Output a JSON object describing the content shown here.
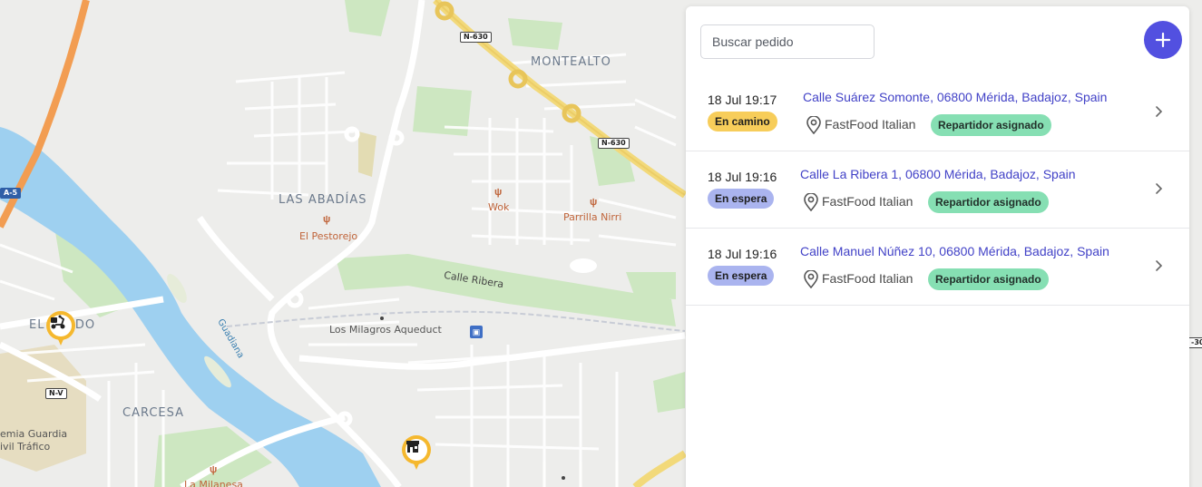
{
  "map": {
    "districts": {
      "montealto": "MONTEALTO",
      "las_abadias": "LAS ABADÍAS",
      "el_prado": "EL PRADO",
      "carcesa": "CARCESA"
    },
    "pois": {
      "wok": "Wok",
      "parrilla": "Parrilla Nirri",
      "pestorejo": "El Pestorejo",
      "milanesa": "La Milanesa",
      "aqueduct": "Los Milagros Aqueduct",
      "academia_line1": "emia Guardia",
      "academia_line2": "ivil Tráfico"
    },
    "streets": {
      "calle_ribera": "Calle Ribera",
      "river": "Guadiana"
    },
    "road_shields": {
      "n630_top": "N-630",
      "n630_right": "N-630",
      "a5": "A-5",
      "nv": "N-V",
      "edge": "-30"
    },
    "marker_icons": {
      "driver": "scooter-icon",
      "restaurant": "store-icon"
    }
  },
  "panel": {
    "search_placeholder": "Buscar pedido",
    "add_icon": "plus-icon",
    "orders": [
      {
        "time": "18 Jul 19:17",
        "status": "En camino",
        "status_color": "#f7cd5a",
        "address": "Calle Suárez Somonte, 06800 Mérida, Badajoz, Spain",
        "restaurant": "FastFood Italian",
        "driver_status": "Repartidor asignado"
      },
      {
        "time": "18 Jul 19:16",
        "status": "En espera",
        "status_color": "#aab4ef",
        "address": "Calle La Ribera 1, 06800 Mérida, Badajoz, Spain",
        "restaurant": "FastFood Italian",
        "driver_status": "Repartidor asignado"
      },
      {
        "time": "18 Jul 19:16",
        "status": "En espera",
        "status_color": "#aab4ef",
        "address": "Calle Manuel Núñez 10, 06800 Mérida, Badajoz, Spain",
        "restaurant": "FastFood Italian",
        "driver_status": "Repartidor asignado"
      }
    ]
  },
  "colors": {
    "accent": "#5250e0",
    "address_link": "#4242c7",
    "assigned_badge": "#86dfb3",
    "marker": "#f5b82e",
    "water": "#9ed0f0",
    "park": "#cde7c1"
  }
}
